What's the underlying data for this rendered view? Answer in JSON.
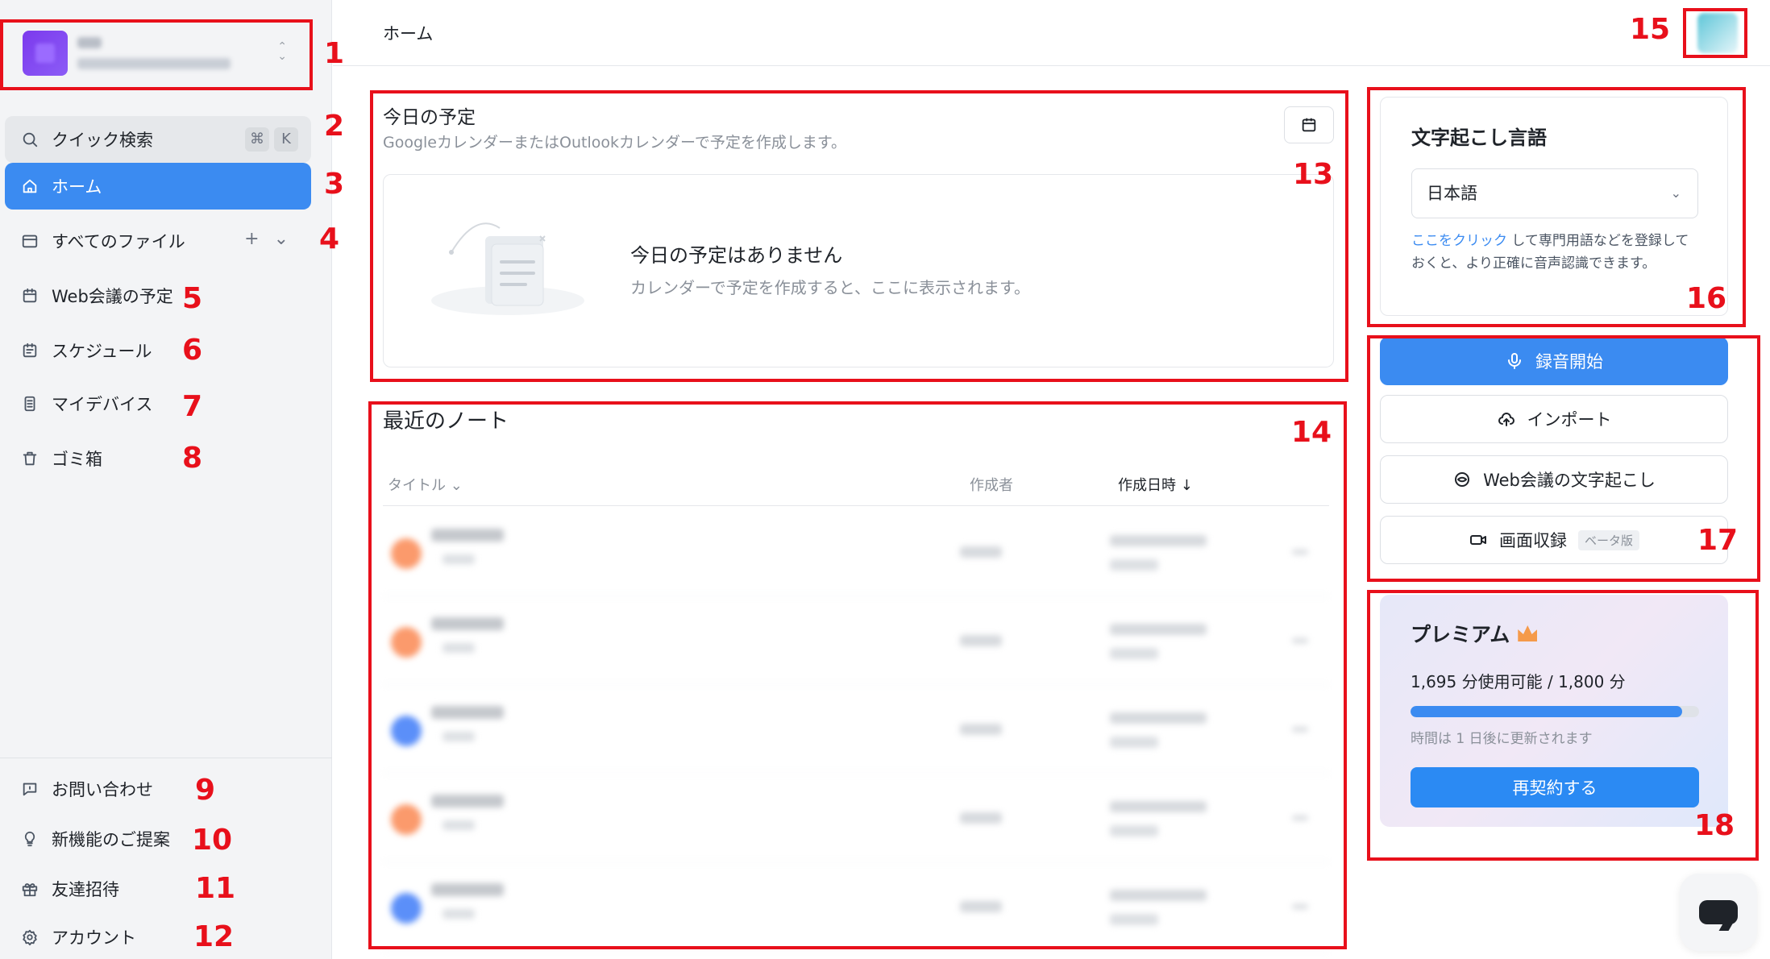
{
  "sidebar": {
    "search": {
      "label": "クイック検索",
      "key1": "⌘",
      "key2": "K"
    },
    "items": [
      {
        "label": "ホーム"
      },
      {
        "label": "すべてのファイル"
      },
      {
        "label": "Web会議の予定"
      },
      {
        "label": "スケジュール"
      },
      {
        "label": "マイデバイス"
      },
      {
        "label": "ゴミ箱"
      }
    ],
    "bottom_items": [
      {
        "label": "お問い合わせ"
      },
      {
        "label": "新機能のご提案"
      },
      {
        "label": "友達招待"
      },
      {
        "label": "アカウント"
      }
    ]
  },
  "header": {
    "title": "ホーム"
  },
  "schedule": {
    "title": "今日の予定",
    "subtitle": "GoogleカレンダーまたはOutlookカレンダーで予定を作成します。",
    "empty_title": "今日の予定はありません",
    "empty_sub": "カレンダーで予定を作成すると、ここに表示されます。"
  },
  "notes": {
    "title": "最近のノート",
    "columns": [
      "タイトル",
      "作成者",
      "作成日時"
    ],
    "sort_arrow": "↓",
    "title_chevron": "⌄",
    "rows": [
      {
        "dot_color": "#fb9a6c"
      },
      {
        "dot_color": "#fb9a6c"
      },
      {
        "dot_color": "#5b8ff9"
      },
      {
        "dot_color": "#fb9a6c"
      },
      {
        "dot_color": "#5b8ff9"
      }
    ]
  },
  "language": {
    "title": "文字起こし言語",
    "selected": "日本語",
    "link_text": "ここをクリック",
    "note_rest": "して専門用語などを登録しておくと、より正確に音声認識できます。"
  },
  "actions": {
    "record": "録音開始",
    "import": "インポート",
    "web_transcribe": "Web会議の文字起こし",
    "screen_record": "画面収録",
    "beta": "ベータ版"
  },
  "premium": {
    "title": "プレミアム",
    "usage": "1,695 分使用可能 / 1,800 分",
    "usage_fraction": 0.9417,
    "note": "時間は 1 日後に更新されます",
    "renew": "再契約する"
  },
  "annotations": [
    "1",
    "2",
    "3",
    "4",
    "5",
    "6",
    "7",
    "8",
    "9",
    "10",
    "11",
    "12",
    "13",
    "14",
    "15",
    "16",
    "17",
    "18"
  ],
  "colors": {
    "accent": "#3b8bf1",
    "annotation": "#e8101b",
    "sidebar_bg": "#f3f4f6"
  }
}
